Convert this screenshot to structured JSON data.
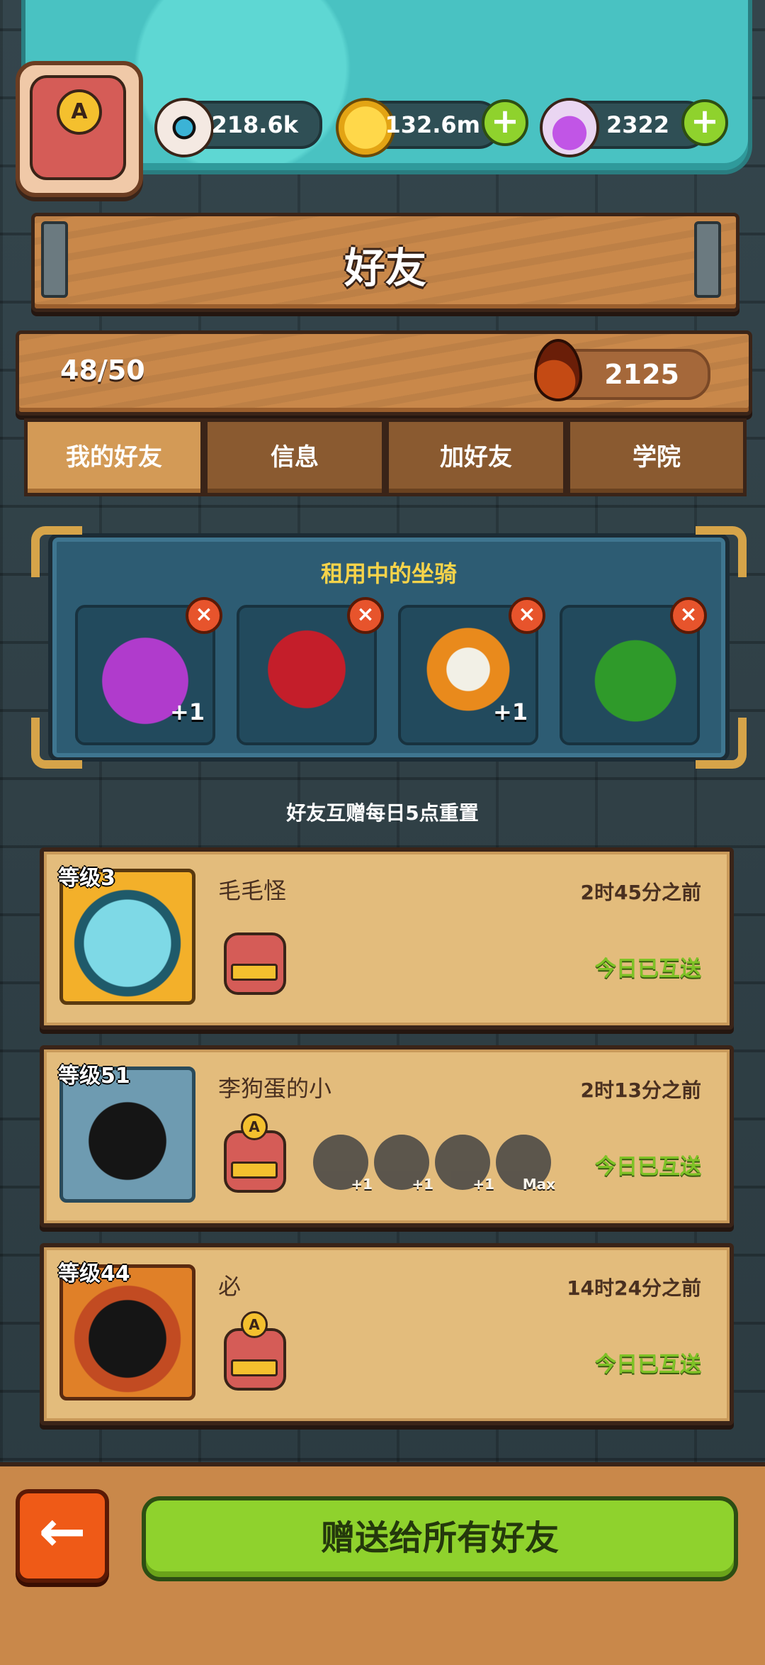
{
  "header": {
    "resources": [
      {
        "name": "eyeball",
        "value": "218.6k"
      },
      {
        "name": "coin",
        "value": "132.6m"
      },
      {
        "name": "potion",
        "value": "2322"
      }
    ],
    "player_badge_letter": "A"
  },
  "panel": {
    "title": "好友"
  },
  "stats": {
    "friend_count": "48/50",
    "drops": "2125"
  },
  "tabs": [
    {
      "label": "我的好友",
      "active": true
    },
    {
      "label": "信息",
      "active": false
    },
    {
      "label": "加好友",
      "active": false
    },
    {
      "label": "学院",
      "active": false
    }
  ],
  "rented_mounts": {
    "title": "租用中的坐骑",
    "items": [
      {
        "name": "purple-demon-mount",
        "badge": "+1"
      },
      {
        "name": "red-rose-mount",
        "badge": ""
      },
      {
        "name": "lion-dance-mount",
        "badge": "+1"
      },
      {
        "name": "christmas-tree-mount",
        "badge": ""
      }
    ]
  },
  "reset_note": "好友互赠每日5点重置",
  "friends": [
    {
      "level": "等级3",
      "name": "毛毛怪",
      "time": "2时45分之前",
      "status": "今日已互送",
      "badge_letter": "",
      "mounts": []
    },
    {
      "level": "等级51",
      "name": "李狗蛋的小",
      "time": "2时13分之前",
      "status": "今日已互送",
      "badge_letter": "A",
      "mounts": [
        {
          "label": "+1"
        },
        {
          "label": "+1"
        },
        {
          "label": "+1"
        },
        {
          "label": "Max"
        }
      ]
    },
    {
      "level": "等级44",
      "name": "必",
      "time": "14时24分之前",
      "status": "今日已互送",
      "badge_letter": "A",
      "mounts": []
    }
  ],
  "footer": {
    "back_icon": "←",
    "gift_all_label": "赠送给所有好友"
  },
  "colors": {
    "accent_green": "#8fd22d",
    "gold_text": "#f6d34a",
    "wood": "#c9884a"
  }
}
